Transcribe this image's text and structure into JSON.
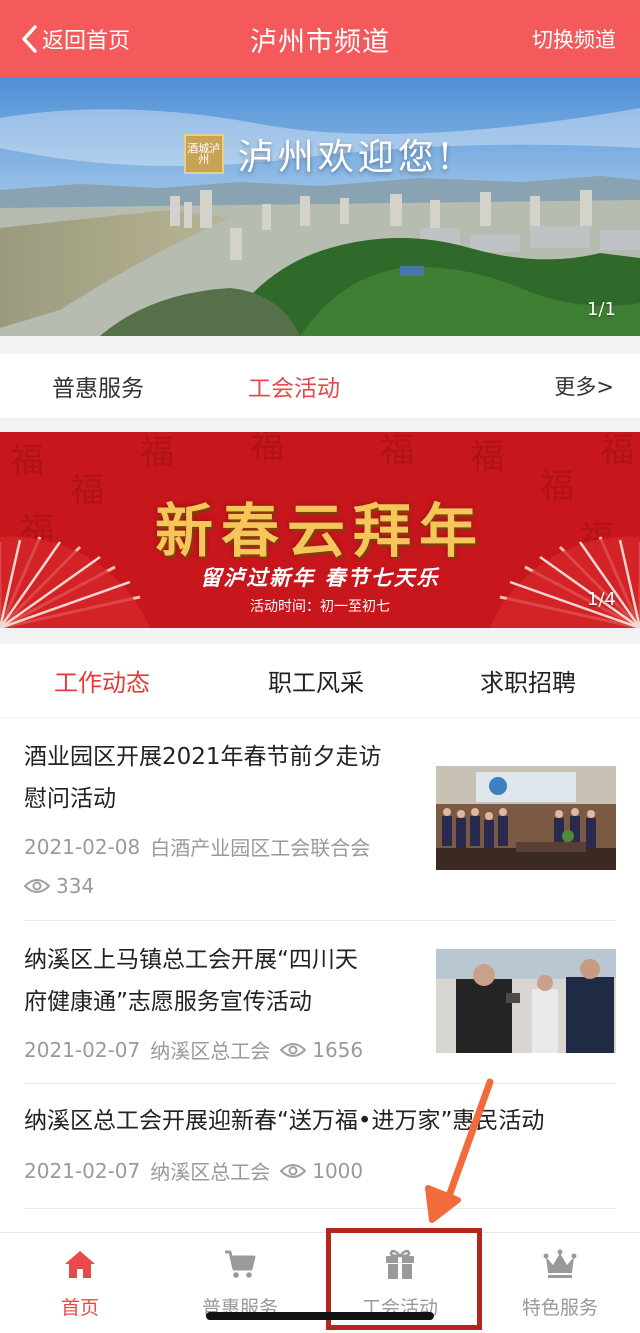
{
  "header": {
    "back_label": "返回首页",
    "title": "泸州市频道",
    "switch_label": "切换频道"
  },
  "banner1": {
    "welcome_text": "泸州欢迎您!",
    "seal_text": "酒城泸州",
    "pager": "1/1"
  },
  "section_tabs": {
    "items": [
      "普惠服务",
      "工会活动"
    ],
    "active_index": 1,
    "more_label": "更多>"
  },
  "banner2": {
    "title": "新春云拜年",
    "subtitle": "留泸过新年 春节七天乐",
    "time": "活动时间：初一至初七",
    "pager": "1/4"
  },
  "sub_tabs": {
    "items": [
      "工作动态",
      "职工风采",
      "求职招聘"
    ],
    "active_index": 0
  },
  "news": [
    {
      "title_line1": "酒业园区开展2021年春节前夕走访",
      "title_line2": "慰问活动",
      "date": "2021-02-08",
      "source": "白酒产业园区工会联合会",
      "views": "334"
    },
    {
      "title_line1": "纳溪区上马镇总工会开展“四川天",
      "title_line2": "府健康通”志愿服务宣传活动",
      "date": "2021-02-07",
      "source": "纳溪区总工会",
      "views": "1656"
    },
    {
      "title_line1": "纳溪区总工会开展迎新春“送万福•进万家”惠民活动",
      "date": "2021-02-07",
      "source": "纳溪区总工会",
      "views": "1000"
    }
  ],
  "bottom_nav": {
    "items": [
      {
        "label": "首页",
        "icon": "home-icon"
      },
      {
        "label": "普惠服务",
        "icon": "cart-icon"
      },
      {
        "label": "工会活动",
        "icon": "gift-icon"
      },
      {
        "label": "特色服务",
        "icon": "crown-icon"
      }
    ],
    "active_index": 0
  },
  "colors": {
    "brand_red": "#f4595c",
    "active_text": "#e9494a",
    "annotation_arrow": "#f26b3a",
    "annotation_box": "#b3261e"
  }
}
